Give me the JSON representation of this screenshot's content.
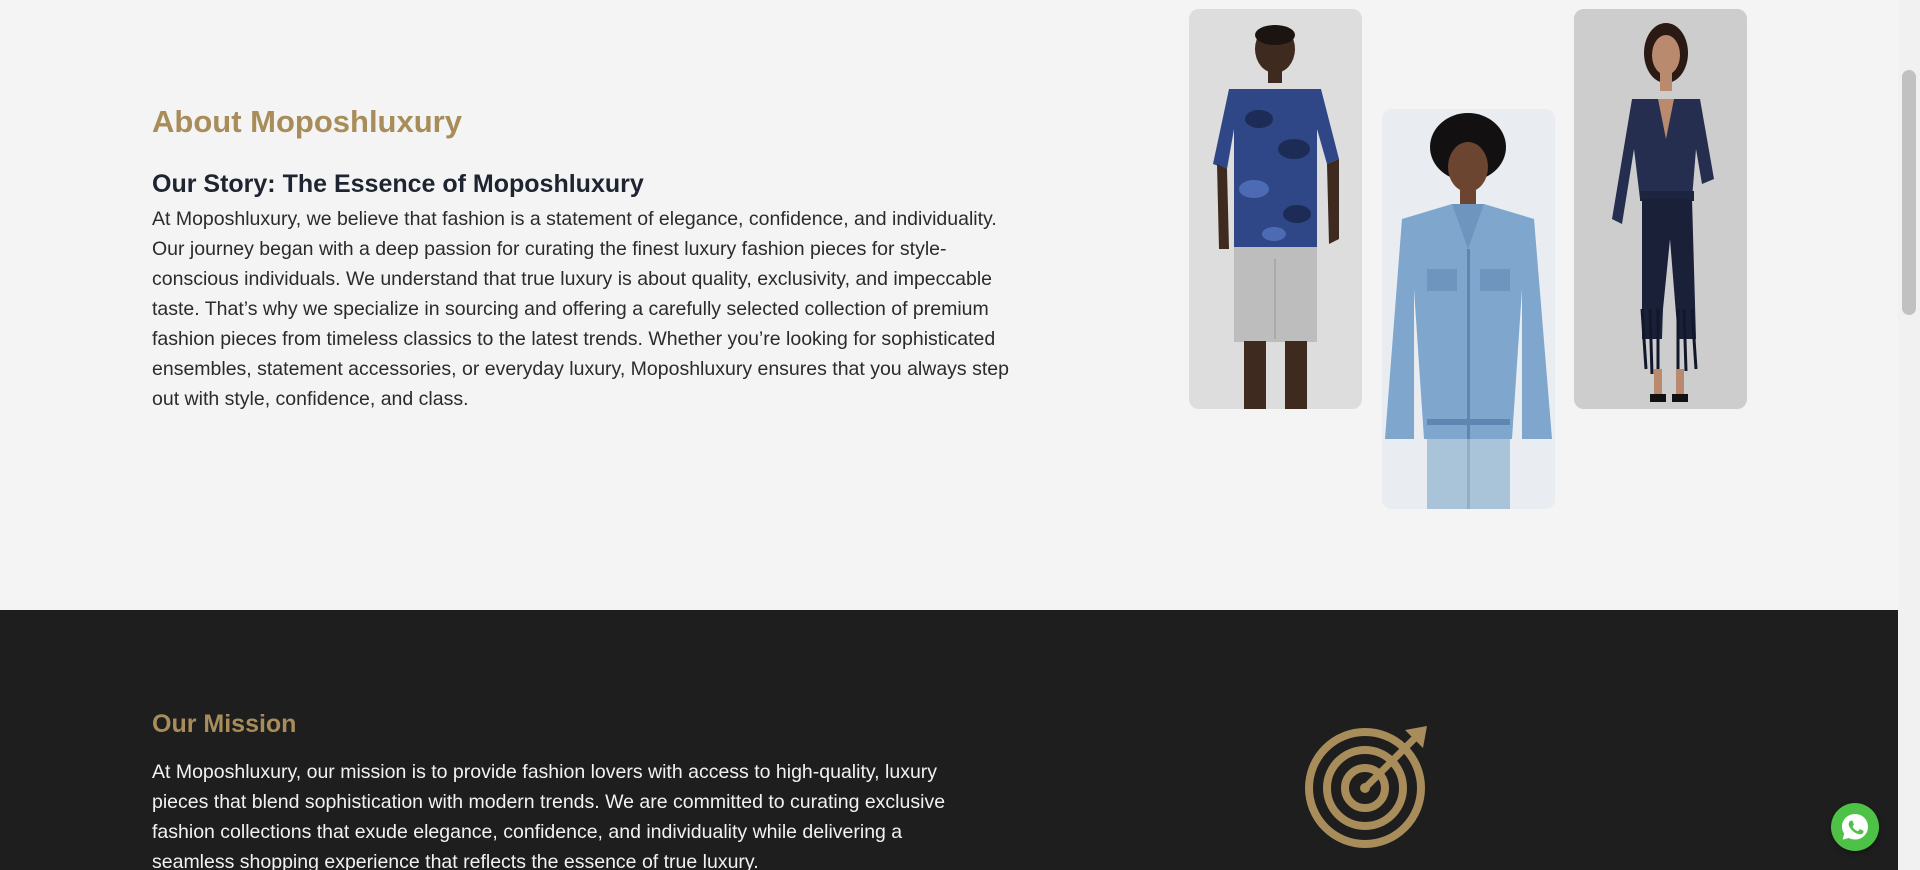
{
  "about": {
    "title": "About Moposhluxury",
    "story_title": "Our Story: The Essence of Moposhluxury",
    "story_text": "At Moposhluxury, we believe that fashion is a statement of elegance, confidence, and individuality. Our journey began with a deep passion for curating the finest luxury fashion pieces for style-conscious individuals. We understand that true luxury is about quality, exclusivity, and impeccable taste. That’s why we specialize in sourcing and offering a carefully selected collection of premium fashion pieces from timeless classics to the latest trends. Whether you’re looking for sophisticated ensembles, statement accessories, or everyday luxury, Moposhluxury ensures that you always step out with style, confidence, and class."
  },
  "mission": {
    "title": "Our Mission",
    "text": "At Moposhluxury, our mission is to provide fashion lovers with access to high-quality, luxury pieces that blend sophistication with modern trends. We are committed to curating exclusive fashion collections that exude elegance, confidence, and individuality while delivering a seamless shopping experience that reflects the essence of true luxury."
  },
  "icons": {
    "mission": "target-icon",
    "chat": "whatsapp-icon"
  },
  "colors": {
    "accent": "#a88c5a",
    "dark_section": "#1e1e1e",
    "light_section": "#f4f4f4",
    "whatsapp": "#4dc247"
  }
}
